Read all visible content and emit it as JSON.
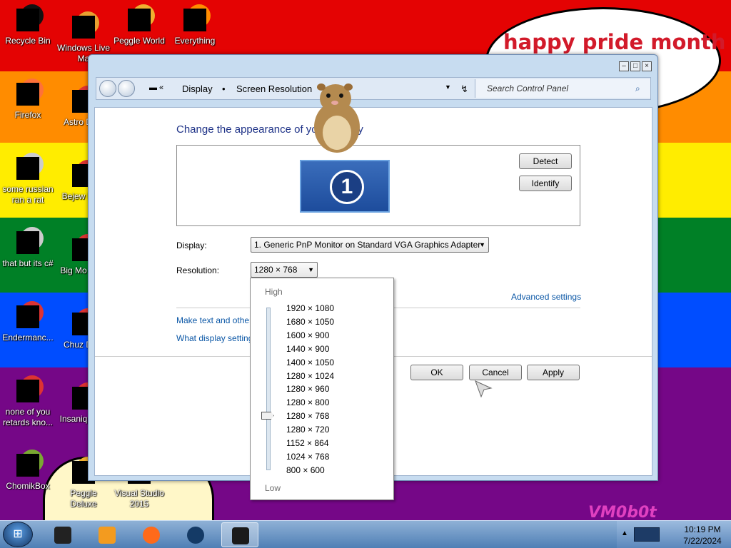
{
  "wallpaper": {
    "speech_text": "happy pride month",
    "watermark": "VM0b0t"
  },
  "desktop_icons": [
    {
      "label": "Recycle Bin",
      "icon": "recycle-bin-icon"
    },
    {
      "label": "Windows Live Ma",
      "icon": "windows-live-icon"
    },
    {
      "label": "Peggle World",
      "icon": "peggle-icon"
    },
    {
      "label": "Everything",
      "icon": "everything-icon"
    },
    {
      "label": "Firefox",
      "icon": "firefox-icon"
    },
    {
      "label": "Astro Delu",
      "icon": "app-icon"
    },
    {
      "label": "some russian ran a rat",
      "icon": "file-icon"
    },
    {
      "label": "Bejew Delu",
      "icon": "app-icon"
    },
    {
      "label": "that but its c#",
      "icon": "file-icon"
    },
    {
      "label": "Big Mo Delu",
      "icon": "app-icon"
    },
    {
      "label": "Endermanc...",
      "icon": "app-icon"
    },
    {
      "label": "Chuz Delu",
      "icon": "app-icon"
    },
    {
      "label": "none of you retards kno...",
      "icon": "app-icon"
    },
    {
      "label": "Insaniq Delu",
      "icon": "app-icon"
    },
    {
      "label": "ChomikBox",
      "icon": "chomikbox-icon"
    },
    {
      "label": "Peggle Deluxe",
      "icon": "peggle-icon"
    },
    {
      "label": "Visual Studio 2015",
      "icon": "visual-studio-icon"
    }
  ],
  "window": {
    "breadcrumb": [
      "Display",
      "Screen Resolution"
    ],
    "search_placeholder": "Search Control Panel",
    "heading": "Change the appearance of your display",
    "monitor_number": "1",
    "detect_label": "Detect",
    "identify_label": "Identify",
    "display_label": "Display:",
    "display_value": "1. Generic PnP Monitor on Standard VGA Graphics Adapter",
    "resolution_label": "Resolution:",
    "resolution_value": "1280 × 768",
    "advanced_link": "Advanced settings",
    "link1": "Make text and other",
    "link2": "What display setting",
    "ok_label": "OK",
    "cancel_label": "Cancel",
    "apply_label": "Apply"
  },
  "dropdown": {
    "high_label": "High",
    "low_label": "Low",
    "options": [
      "1920 × 1080",
      "1680 × 1050",
      "1600 × 900",
      "1440 × 900",
      "1400 × 1050",
      "1280 × 1024",
      "1280 × 960",
      "1280 × 800",
      "1280 × 768",
      "1280 × 720",
      "1152 × 864",
      "1024 × 768",
      "800 × 600"
    ],
    "selected": "1280 × 768"
  },
  "taskbar": {
    "items": [
      "file-manager-icon",
      "media-player-icon",
      "firefox-icon",
      "globe-icon",
      "display-settings-icon"
    ],
    "time": "10:19 PM",
    "date": "7/22/2024"
  }
}
